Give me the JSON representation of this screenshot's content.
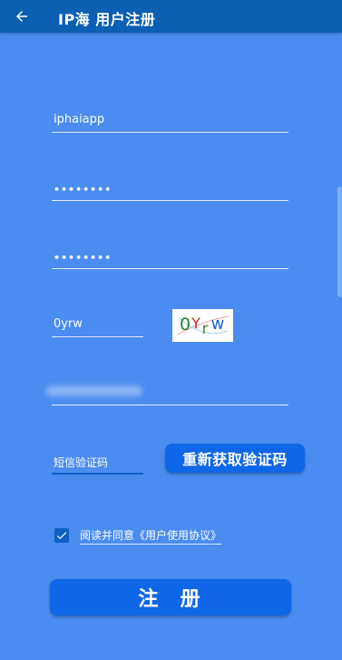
{
  "appbar": {
    "title": "IP海 用户注册",
    "back_icon": "arrow-left-icon",
    "color": "#0c5fb3"
  },
  "form": {
    "username": {
      "value": "iphaiapp"
    },
    "password": {
      "value": "••••••••"
    },
    "confirm_password": {
      "value": "••••••••"
    },
    "captcha_input": {
      "value": "0yrw"
    },
    "captcha_image": {
      "text": "0Yrw"
    },
    "sms_code": {
      "placeholder": "短信验证码"
    }
  },
  "sms_button": {
    "label": "重新获取验证码"
  },
  "agreement": {
    "checked": true,
    "text": "阅读并同意《用户使用协议》"
  },
  "register_button": {
    "label": "注  册"
  },
  "colors": {
    "background": "#4a8cf0",
    "button": "#0f66e6",
    "checkbox": "#0d5fc4"
  }
}
